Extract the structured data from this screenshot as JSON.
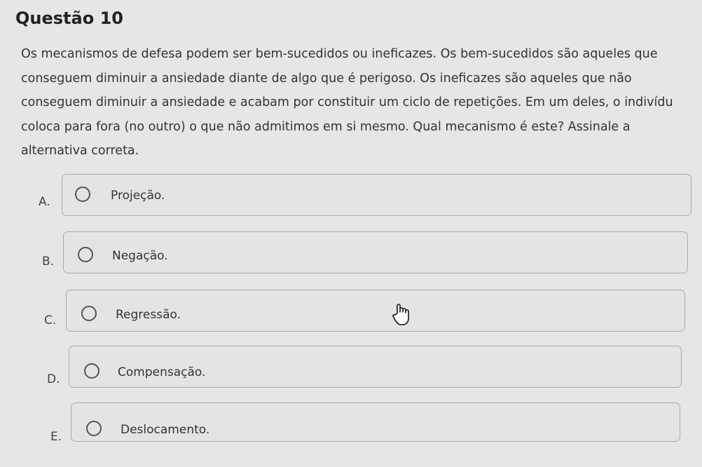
{
  "question": {
    "title": "Questão 10",
    "text": "Os mecanismos de defesa podem ser bem-sucedidos ou ineficazes. Os bem-sucedidos são aqueles que\nconseguem diminuir a ansiedade diante de algo que é perigoso. Os ineficazes são aqueles que não\nconseguem diminuir a ansiedade e acabam por constituir um ciclo de repetições. Em um deles, o indivídu\ncoloca para fora (no outro) o que não admitimos em si mesmo. Qual mecanismo é este? Assinale a\nalternativa correta."
  },
  "options": [
    {
      "letter": "A.",
      "label": "Projeção."
    },
    {
      "letter": "B.",
      "label": "Negação."
    },
    {
      "letter": "C.",
      "label": "Regressão."
    },
    {
      "letter": "D.",
      "label": "Compensação."
    },
    {
      "letter": "E.",
      "label": "Deslocamento."
    }
  ],
  "cursor": {
    "icon": "hand-pointer-icon"
  }
}
